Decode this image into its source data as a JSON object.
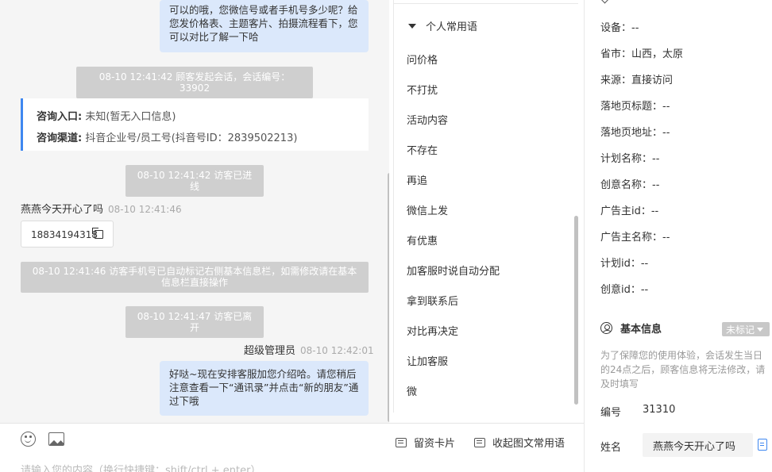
{
  "chat": {
    "messages": [
      {
        "type": "agent_bubble",
        "text": "可以的哦，您微信号或者手机号多少呢？给您发价格表、主题客片、拍摄流程看下，您可以对比了解一下哈"
      },
      {
        "type": "system",
        "text": "08-10 12:41:42 顾客发起会话，会话编号：33902"
      },
      {
        "type": "system",
        "text": "08-10 12:41:42 访客已进线"
      },
      {
        "type": "system",
        "text": "08-10 12:41:46 访客手机号已自动标记右侧基本信息栏，如需修改请在基本信息栏直接操作"
      },
      {
        "type": "system",
        "text": "08-10 12:41:47 访客已离开"
      },
      {
        "type": "agent_bubble",
        "text": "好哒~现在安排客服加您介绍哈。请您稍后注意查看一下“通讯录”并点击“新的朋友”通过下哦"
      }
    ],
    "entry_card": {
      "entry_label": "咨询入口:",
      "entry_value": "未知(暂无入口信息)",
      "channel_label": "咨询渠道:",
      "channel_value": "抖音企业号/员工号(抖音号ID：2839502213)"
    },
    "visitor": {
      "name": "燕燕今天开心了吗",
      "time": "08-10 12:41:46",
      "phone": "18834194318"
    },
    "agent": {
      "name": "超级管理员",
      "time": "08-10 12:42:01"
    }
  },
  "toolbar": {
    "emoji_icon": "emoji-icon",
    "image_icon": "image-icon",
    "card_button": "留资卡片",
    "collapse_button": "收起图文常用语",
    "input_placeholder": "请输入您的内容（换行快捷键：shift/ctrl + enter）"
  },
  "phrases": {
    "group_title": "个人常用语",
    "items": [
      "问价格",
      "不打扰",
      "活动内容",
      "不存在",
      "再追",
      "微信上发",
      "有优惠",
      "加客服时说自动分配",
      "拿到联系后",
      "对比再决定",
      "让加客服",
      "微"
    ]
  },
  "info": {
    "rows": [
      "设备：--",
      "省市：山西，太原",
      "来源：直接访问",
      "落地页标题：--",
      "落地页地址：--",
      "计划名称：--",
      "创意名称：--",
      "广告主id：--",
      "广告主名称：--",
      "计划id：--",
      "创意id：--"
    ],
    "section_title": "基本信息",
    "badge": "未标记",
    "note": "为了保障您的使用体验，会话发生当日的24点之后，顾客信息将无法修改，请及时填写",
    "id_label": "编号",
    "id_value": "31310",
    "name_label": "姓名",
    "name_value": "燕燕今天开心了吗"
  },
  "colors": {
    "accent": "#3e87f0",
    "agent_bubble": "#dbe8fb",
    "system_msg": "#cfcfcf",
    "chat_bg": "#f5f5f5"
  }
}
